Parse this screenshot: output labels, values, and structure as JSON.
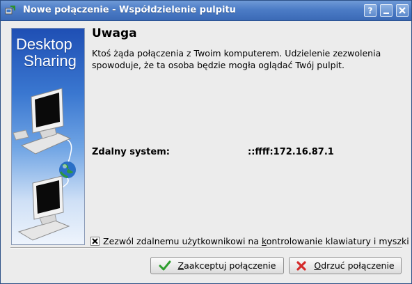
{
  "window": {
    "title": "Nowe połączenie - Współdzielenie pulpitu",
    "icons": [
      "app-icon",
      "help-icon",
      "minimize-icon",
      "close-icon"
    ]
  },
  "banner": {
    "line1": "Desktop",
    "line2": "Sharing"
  },
  "dialog": {
    "heading": "Uwaga",
    "message": "Ktoś żąda połączenia z Twoim komputerem. Udzielenie zezwolenia spowoduje, że ta osoba będzie mogła oglądać Twój pulpit.",
    "remote_label": "Zdalny system:",
    "remote_value": "::ffff:172.16.87.1",
    "checkbox": {
      "label_before": "Zezwól zdalnemu użytkownikowi na ",
      "label_mnemonic": "k",
      "label_after": "ontrolowanie klawiatury i myszki",
      "checked": true
    }
  },
  "buttons": {
    "accept_mnemonic": "Z",
    "accept_rest": "aakceptuj połączenie",
    "reject_mnemonic": "O",
    "reject_rest": "drzuć połączenie"
  },
  "colors": {
    "titlebar": "#4c7cc6",
    "accept_icon": "#2e9e2e",
    "reject_icon": "#d42a2a"
  }
}
